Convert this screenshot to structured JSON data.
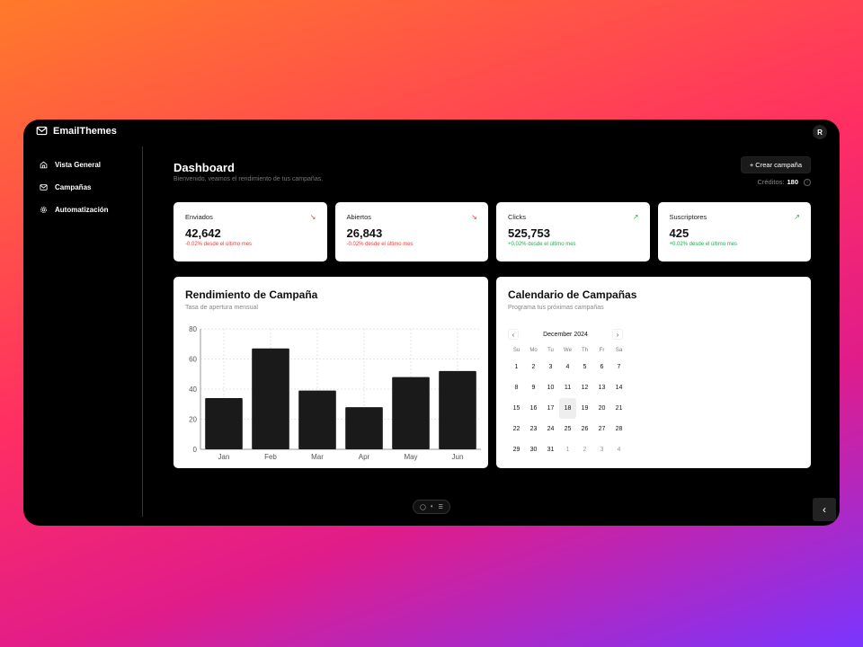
{
  "app": {
    "name": "EmailThemes",
    "user_initial": "R"
  },
  "sidebar": {
    "items": [
      {
        "label": "Vista General",
        "icon": "home-icon"
      },
      {
        "label": "Campañas",
        "icon": "mail-icon"
      },
      {
        "label": "Automatización",
        "icon": "gear-icon"
      }
    ]
  },
  "header": {
    "title": "Dashboard",
    "subtitle": "Bienvenido, veamos el rendimiento de tus campañas.",
    "create_button": "+ Crear campaña",
    "credits_label": "Créditos:",
    "credits_value": "180"
  },
  "stats": [
    {
      "label": "Enviados",
      "value": "42,642",
      "delta": "-0.02% desde el último mes",
      "trend": "down",
      "trend_icon": "↘"
    },
    {
      "label": "Abiertos",
      "value": "26,843",
      "delta": "-0.02% desde el último mes",
      "trend": "down",
      "trend_icon": "↘"
    },
    {
      "label": "Clicks",
      "value": "525,753",
      "delta": "+0.02% desde el último mes",
      "trend": "up",
      "trend_icon": "↗"
    },
    {
      "label": "Suscriptores",
      "value": "425",
      "delta": "+0.02% desde el último mes",
      "trend": "up",
      "trend_icon": "↗"
    }
  ],
  "performance": {
    "title": "Rendimiento de Campaña",
    "subtitle": "Tasa de apertura mensual"
  },
  "chart_data": {
    "type": "bar",
    "categories": [
      "Jan",
      "Feb",
      "Mar",
      "Apr",
      "May",
      "Jun"
    ],
    "values": [
      34,
      67,
      39,
      28,
      48,
      52
    ],
    "ylim": [
      0,
      80
    ],
    "yticks": [
      0,
      20,
      40,
      60,
      80
    ],
    "grid": true,
    "bar_color": "#1a1a1a"
  },
  "calendar": {
    "title": "Calendario de Campañas",
    "subtitle": "Programa tus próximas campañas",
    "month": "December 2024",
    "weekdays": [
      "Su",
      "Mo",
      "Tu",
      "We",
      "Th",
      "Fr",
      "Sa"
    ],
    "days": [
      "1",
      "2",
      "3",
      "4",
      "5",
      "6",
      "7",
      "8",
      "9",
      "10",
      "11",
      "12",
      "13",
      "14",
      "15",
      "16",
      "17",
      "18",
      "19",
      "20",
      "21",
      "22",
      "23",
      "24",
      "25",
      "26",
      "27",
      "28",
      "29",
      "30",
      "31",
      "1",
      "2",
      "3",
      "4"
    ],
    "today_index": 17,
    "muted_from_index": 31
  },
  "colors": {
    "negative": "#ef3a3a",
    "positive": "#17b24a",
    "background": "#000000",
    "card": "#ffffff"
  }
}
